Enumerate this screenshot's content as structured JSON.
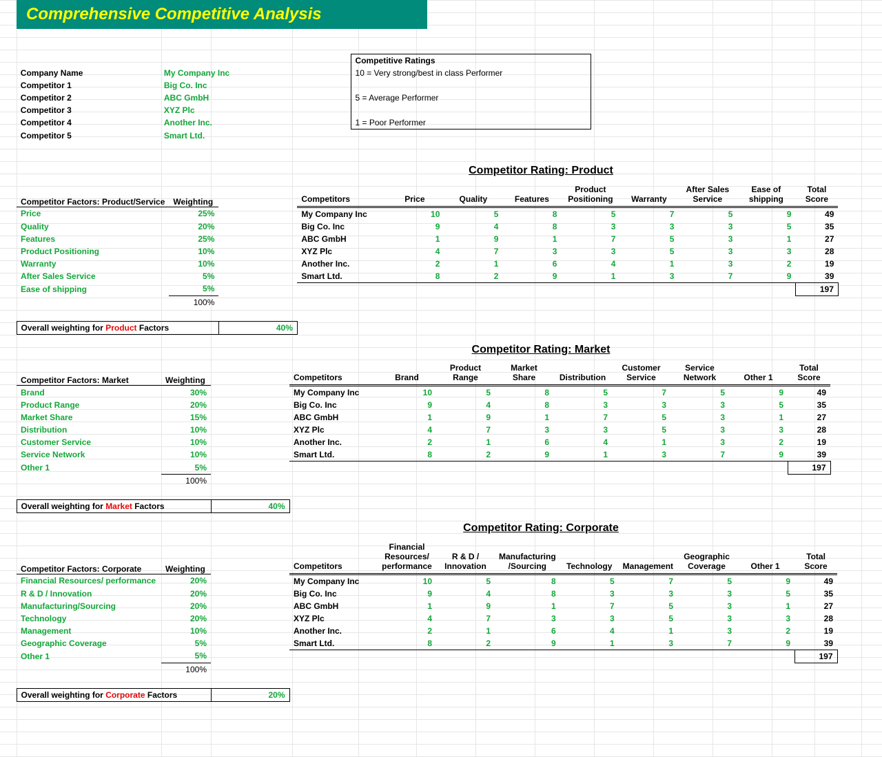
{
  "title": "Comprehensive Competitive Analysis",
  "companies": {
    "labels": [
      "Company Name",
      "Competitor 1",
      "Competitor 2",
      "Competitor 3",
      "Competitor 4",
      "Competitor 5"
    ],
    "names": [
      "My Company Inc",
      "Big Co. Inc",
      "ABC GmbH",
      "XYZ Plc",
      "Another Inc.",
      "Smart Ltd."
    ]
  },
  "ratings_legend": {
    "title": "Competitive Ratings",
    "line1": "10 = Very strong/best in class Performer",
    "line2": "5 = Average Performer",
    "line3": "1 = Poor Performer"
  },
  "sections": {
    "product": {
      "factors_header": "Competitor Factors: Product/Service",
      "weight_header": "Weighting",
      "rating_title": "Competitor Rating: Product",
      "columns": [
        "Competitors",
        "Price",
        "Quality",
        "Features",
        "Product Positioning",
        "Warranty",
        "After Sales Service",
        "Ease of shipping",
        "Total Score"
      ],
      "factors": [
        {
          "name": "Price",
          "w": "25%"
        },
        {
          "name": "Quality",
          "w": "20%"
        },
        {
          "name": "Features",
          "w": "25%"
        },
        {
          "name": "Product Positioning",
          "w": "10%"
        },
        {
          "name": "Warranty",
          "w": "10%"
        },
        {
          "name": "After Sales Service",
          "w": "5%"
        },
        {
          "name": "Ease of shipping",
          "w": "5%"
        }
      ],
      "total_w": "100%",
      "overall_label_pre": "Overall weighting for ",
      "overall_label_word": "Product",
      "overall_label_post": " Factors",
      "overall_pct": "40%"
    },
    "market": {
      "factors_header": "Competitor Factors: Market",
      "weight_header": "Weighting",
      "rating_title": "Competitor Rating: Market",
      "columns": [
        "Competitors",
        "Brand",
        "Product Range",
        "Market Share",
        "Distribution",
        "Customer Service",
        "Service Network",
        "Other 1",
        "Total Score"
      ],
      "factors": [
        {
          "name": "Brand",
          "w": "30%"
        },
        {
          "name": "Product Range",
          "w": "20%"
        },
        {
          "name": "Market Share",
          "w": "15%"
        },
        {
          "name": "Distribution",
          "w": "10%"
        },
        {
          "name": "Customer Service",
          "w": "10%"
        },
        {
          "name": "Service Network",
          "w": "10%"
        },
        {
          "name": "Other 1",
          "w": "5%"
        }
      ],
      "total_w": "100%",
      "overall_label_pre": "Overall weighting for ",
      "overall_label_word": "Market",
      "overall_label_post": " Factors",
      "overall_pct": "40%"
    },
    "corporate": {
      "factors_header": "Competitor Factors: Corporate",
      "weight_header": "Weighting",
      "rating_title": "Competitor Rating: Corporate",
      "columns": [
        "Competitors",
        "Financial Resources/ performance",
        "R & D / Innovation",
        "Manufacturing /Sourcing",
        "Technology",
        "Management",
        "Geographic Coverage",
        "Other 1",
        "Total Score"
      ],
      "factors": [
        {
          "name": "Financial Resources/ performance",
          "w": "20%"
        },
        {
          "name": "R & D / Innovation",
          "w": "20%"
        },
        {
          "name": "Manufacturing/Sourcing",
          "w": "20%"
        },
        {
          "name": "Technology",
          "w": "20%"
        },
        {
          "name": "Management",
          "w": "10%"
        },
        {
          "name": "Geographic Coverage",
          "w": "5%"
        },
        {
          "name": "Other 1",
          "w": "5%"
        }
      ],
      "total_w": "100%",
      "overall_label_pre": "Overall weighting for ",
      "overall_label_word": "Corporate",
      "overall_label_post": " Factors",
      "overall_pct": "20%"
    }
  },
  "rating_rows": [
    {
      "name": "My Company Inc",
      "v": [
        "10",
        "5",
        "8",
        "5",
        "7",
        "5",
        "9"
      ],
      "total": "49"
    },
    {
      "name": "Big Co. Inc",
      "v": [
        "9",
        "4",
        "8",
        "3",
        "3",
        "3",
        "5"
      ],
      "total": "35"
    },
    {
      "name": "ABC GmbH",
      "v": [
        "1",
        "9",
        "1",
        "7",
        "5",
        "3",
        "1"
      ],
      "total": "27"
    },
    {
      "name": "XYZ Plc",
      "v": [
        "4",
        "7",
        "3",
        "3",
        "5",
        "3",
        "3"
      ],
      "total": "28"
    },
    {
      "name": "Another Inc.",
      "v": [
        "2",
        "1",
        "6",
        "4",
        "1",
        "3",
        "2"
      ],
      "total": "19"
    },
    {
      "name": "Smart Ltd.",
      "v": [
        "8",
        "2",
        "9",
        "1",
        "3",
        "7",
        "9"
      ],
      "total": "39"
    }
  ],
  "grand_total": "197"
}
